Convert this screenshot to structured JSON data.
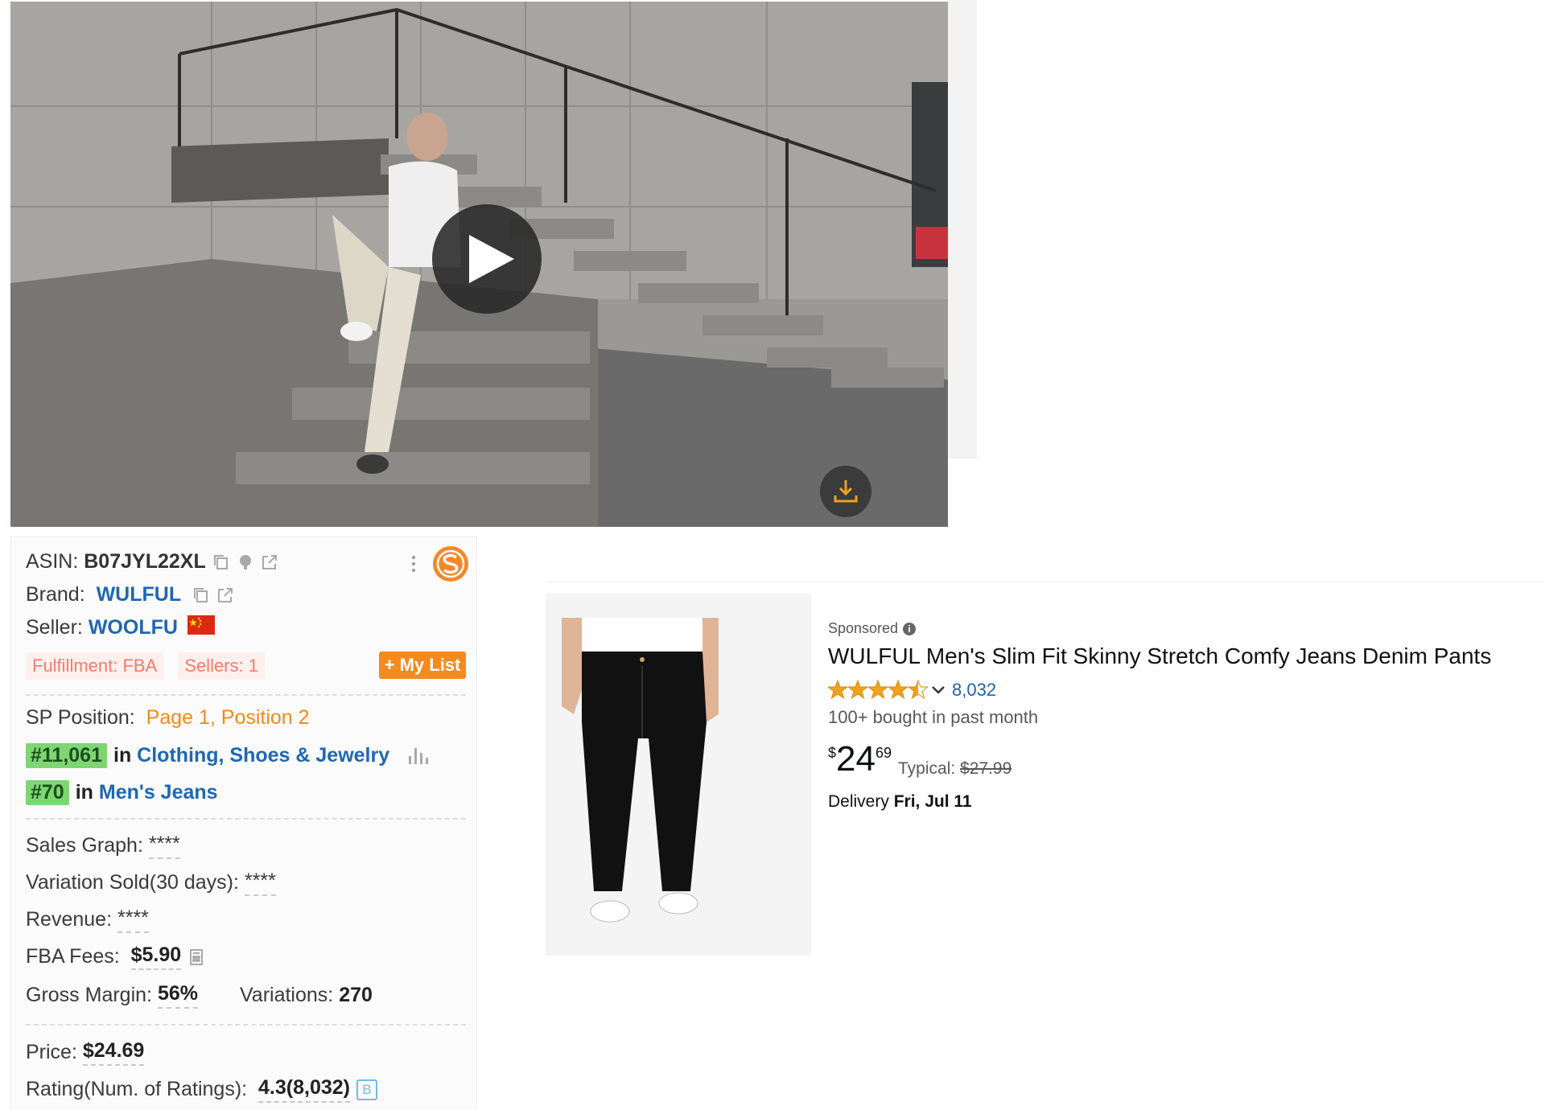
{
  "asin": {
    "label": "ASIN:",
    "value": "B07JYL22XL"
  },
  "brand": {
    "label": "Brand:",
    "value": "WULFUL"
  },
  "seller": {
    "label": "Seller:",
    "value": "WOOLFU"
  },
  "chips": {
    "fulfillment": "Fulfillment: FBA",
    "sellers": "Sellers: 1"
  },
  "my_list_label": "+ My List",
  "sp_position": {
    "label": "SP Position:",
    "value": "Page 1, Position 2"
  },
  "ranks": [
    {
      "rank": "#11,061",
      "in": "in",
      "category": "Clothing, Shoes & Jewelry"
    },
    {
      "rank": "#70",
      "in": "in",
      "category": "Men's Jeans"
    }
  ],
  "metrics": {
    "sales_graph": {
      "label": "Sales Graph:",
      "value": "****"
    },
    "variation_sold": {
      "label": "Variation Sold(30 days):",
      "value": "****"
    },
    "revenue": {
      "label": "Revenue:",
      "value": "****"
    },
    "fba_fees": {
      "label": "FBA Fees:",
      "value": "$5.90"
    },
    "gross_margin": {
      "label": "Gross Margin:",
      "value": "56%"
    },
    "variations": {
      "label": "Variations:",
      "value": "270"
    },
    "price": {
      "label": "Price:",
      "value": "$24.69"
    },
    "rating": {
      "label": "Rating(Num. of Ratings):",
      "value": "4.3(8,032)",
      "badge": "B"
    }
  },
  "product": {
    "sponsored": "Sponsored",
    "title": "WULFUL Men's Slim Fit Skinny Stretch Comfy Jeans Denim Pants",
    "rating_value": 4.3,
    "rating_count": "8,032",
    "bought": "100+ bought in past month",
    "price_symbol": "$",
    "price_whole": "24",
    "price_fraction": "69",
    "typical_label": "Typical:",
    "typical_price": "$27.99",
    "delivery_label": "Delivery",
    "delivery_date": "Fri, Jul 11"
  },
  "colors": {
    "accent_orange": "#f58a1f",
    "link_blue": "#1f67b1",
    "rank_green": "#7ed672",
    "star": "#f0a21d"
  }
}
